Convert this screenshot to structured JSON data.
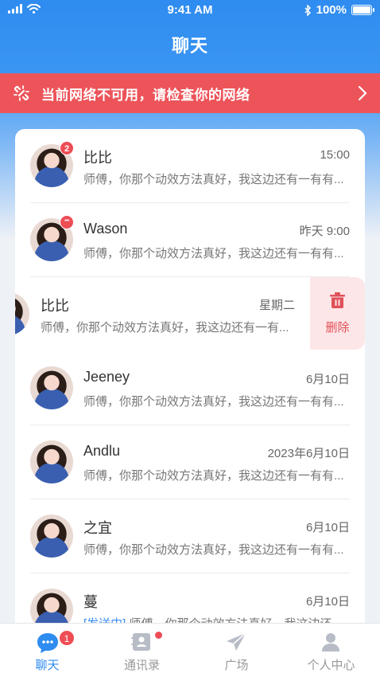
{
  "status_bar": {
    "time": "9:41 AM",
    "battery": "100%"
  },
  "header": {
    "title": "聊天"
  },
  "network_banner": {
    "text": "当前网络不可用，请检查你的网络"
  },
  "chats": [
    {
      "name": "比比",
      "time": "15:00",
      "preview": "师傅，你那个动效方法真好，我这边还有一有有...",
      "badge": "2"
    },
    {
      "name": "Wason",
      "time": "昨天 9:00",
      "preview": "师傅，你那个动效方法真好，我这边还有一有有..."
    },
    {
      "name": "比比",
      "time": "星期二",
      "preview": "师傅，你那个动效方法真好，我这边还有一有..."
    },
    {
      "name": "Jeeney",
      "time": "6月10日",
      "preview": "师傅，你那个动效方法真好，我这边还有一有有..."
    },
    {
      "name": "Andlu",
      "time": "2023年6月10日",
      "preview": "师傅，你那个动效方法真好，我这边还有一有有..."
    },
    {
      "name": "之宜",
      "time": "6月10日",
      "preview": "师傅，你那个动效方法真好，我这边还有一有有..."
    },
    {
      "name": "蔓",
      "time": "6月10日",
      "sending_tag": "[发送中]",
      "preview": "师傅，你那个动效方法真好，我这边还..."
    }
  ],
  "swipe_action": {
    "label": "删除"
  },
  "tabs": [
    {
      "label": "聊天",
      "badge": "1"
    },
    {
      "label": "通讯录"
    },
    {
      "label": "广场"
    },
    {
      "label": "个人中心"
    }
  ],
  "colors": {
    "primary": "#2f8cf0",
    "alert": "#ec5459",
    "badge": "#ee4d55",
    "delete_bg": "#fde6e7"
  }
}
